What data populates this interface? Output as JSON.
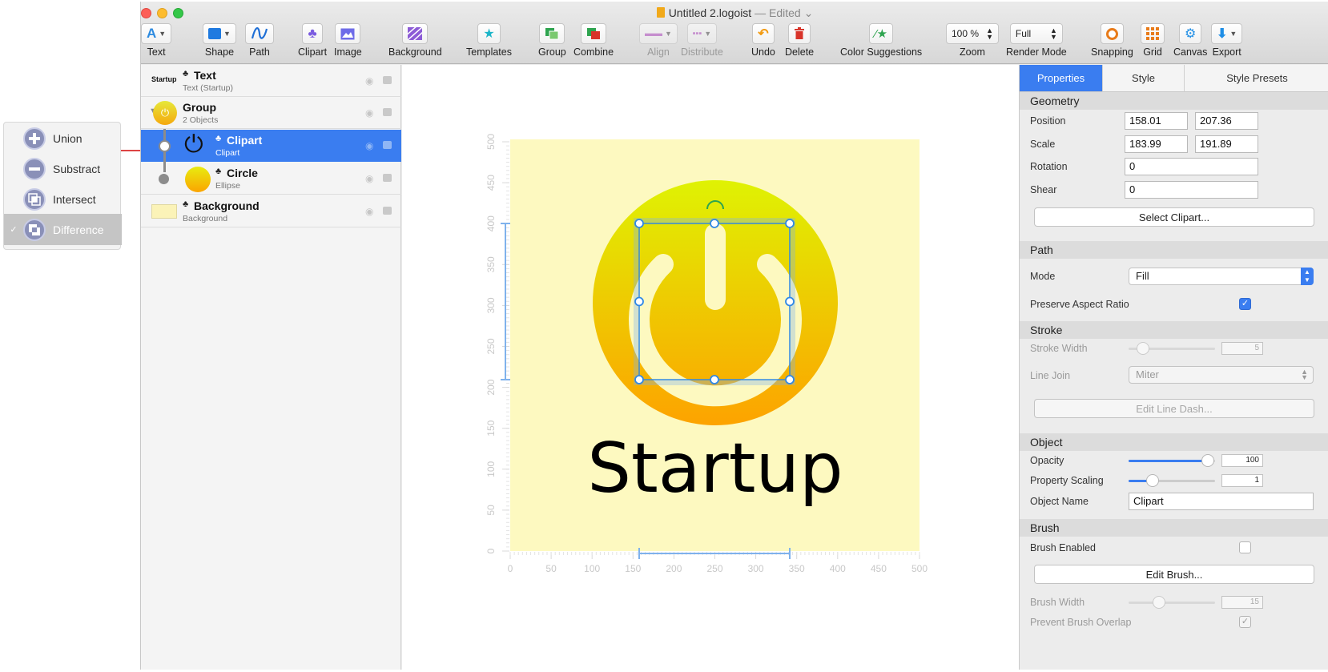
{
  "window": {
    "title": "Untitled 2.logoist",
    "status": "— Edited"
  },
  "popup_menu": {
    "items": [
      {
        "label": "Union",
        "checked": false
      },
      {
        "label": "Substract",
        "checked": false
      },
      {
        "label": "Intersect",
        "checked": false
      },
      {
        "label": "Difference",
        "checked": true
      }
    ]
  },
  "toolbar": {
    "text": "Text",
    "shape": "Shape",
    "path": "Path",
    "clipart": "Clipart",
    "image": "Image",
    "background": "Background",
    "templates": "Templates",
    "group": "Group",
    "combine": "Combine",
    "align": "Align",
    "distribute": "Distribute",
    "undo": "Undo",
    "delete": "Delete",
    "color_suggestions": "Color Suggestions",
    "zoom": "Zoom",
    "zoom_value": "100 %",
    "render_mode": "Render Mode",
    "render_value": "Full",
    "snapping": "Snapping",
    "grid": "Grid",
    "canvas": "Canvas",
    "export": "Export"
  },
  "layers": [
    {
      "name": "Text",
      "subtitle": "Text (Startup)",
      "thumb": "Startup"
    },
    {
      "name": "Group",
      "subtitle": "2 Objects"
    },
    {
      "name": "Clipart",
      "subtitle": "Clipart",
      "selected": true
    },
    {
      "name": "Circle",
      "subtitle": "Ellipse"
    },
    {
      "name": "Background",
      "subtitle": "Background"
    }
  ],
  "canvas": {
    "logo_text": "Startup",
    "x_ticks": [
      "0",
      "50",
      "100",
      "150",
      "200",
      "250",
      "300",
      "350",
      "400",
      "450",
      "500"
    ],
    "y_ticks": [
      "0",
      "50",
      "100",
      "150",
      "200",
      "250",
      "300",
      "350",
      "400",
      "450",
      "500"
    ],
    "colors": {
      "background": "#fdf9c0",
      "circle_top": "#dff203",
      "circle_bottom": "#fda300",
      "icon": "#fdf9c0",
      "selection": "#2f88e6"
    }
  },
  "properties": {
    "tabs": [
      "Properties",
      "Style",
      "Style Presets"
    ],
    "geometry": {
      "header": "Geometry",
      "position_label": "Position",
      "position_x": "158.01",
      "position_y": "207.36",
      "scale_label": "Scale",
      "scale_x": "183.99",
      "scale_y": "191.89",
      "rotation_label": "Rotation",
      "rotation": "0",
      "shear_label": "Shear",
      "shear": "0",
      "select_clipart": "Select Clipart..."
    },
    "path": {
      "header": "Path",
      "mode_label": "Mode",
      "mode": "Fill",
      "preserve_label": "Preserve Aspect Ratio",
      "preserve": true
    },
    "stroke": {
      "header": "Stroke",
      "width_label": "Stroke Width",
      "width": "5",
      "join_label": "Line Join",
      "join": "Miter",
      "edit_dash": "Edit Line Dash..."
    },
    "object": {
      "header": "Object",
      "opacity_label": "Opacity",
      "opacity": "100",
      "opacity_fraction": 0.92,
      "scaling_label": "Property Scaling",
      "scaling": "1",
      "scaling_fraction": 0.28,
      "name_label": "Object Name",
      "name": "Clipart"
    },
    "brush": {
      "header": "Brush",
      "enabled_label": "Brush Enabled",
      "enabled": false,
      "edit": "Edit Brush...",
      "width_label": "Brush Width",
      "width": "15",
      "overlap_label": "Prevent Brush Overlap",
      "overlap": true
    }
  }
}
